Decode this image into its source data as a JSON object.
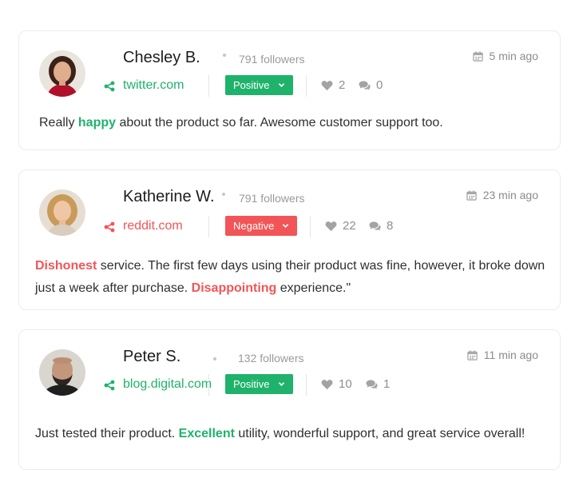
{
  "colors": {
    "positive": "#1fb26b",
    "negative": "#f25557",
    "muted": "#8f8f8f"
  },
  "posts": [
    {
      "author": "Chesley B.",
      "followers": "791 followers",
      "time": "5 min ago",
      "source": "twitter.com",
      "sentiment": "Positive",
      "likes": "2",
      "comments": "0",
      "text": {
        "before": "Really ",
        "highlight": "happy",
        "after": " about the product so far. Awesome customer support too."
      },
      "icons": [
        "avatar",
        "calendar-icon",
        "share-icon",
        "chevron-down-icon",
        "heart-icon",
        "comment-icon"
      ]
    },
    {
      "author": "Katherine W.",
      "followers": "791 followers",
      "time": "23 min ago",
      "source": "reddit.com",
      "sentiment": "Negative",
      "likes": "22",
      "comments": "8",
      "text": {
        "highlight1": "Dishonest",
        "middle": " service. The first few days using their product was fine, however, it broke down just a week after purchase. ",
        "highlight2": "Disappointing",
        "after": " experience.\""
      },
      "icons": [
        "avatar",
        "calendar-icon",
        "share-icon",
        "chevron-down-icon",
        "heart-icon",
        "comment-icon"
      ]
    },
    {
      "author": "Peter S.",
      "followers": "132 followers",
      "time": "11 min ago",
      "source": "blog.digital.com",
      "sentiment": "Positive",
      "likes": "10",
      "comments": "1",
      "text": {
        "before": "Just tested their product. ",
        "highlight": "Excellent",
        "after": " utility, wonderful support, and great service overall!"
      },
      "icons": [
        "avatar",
        "calendar-icon",
        "share-icon",
        "chevron-down-icon",
        "heart-icon",
        "comment-icon"
      ]
    }
  ]
}
